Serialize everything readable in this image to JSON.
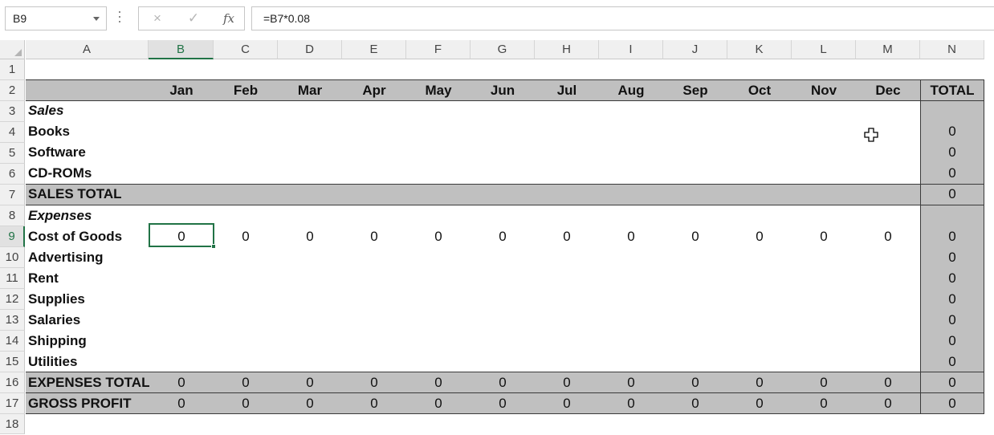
{
  "name_box": {
    "value": "B9"
  },
  "formula_bar": {
    "cancel_icon": "×",
    "enter_icon": "✓",
    "fx_label": "fx",
    "formula": "=B7*0.08"
  },
  "columns": [
    "A",
    "B",
    "C",
    "D",
    "E",
    "F",
    "G",
    "H",
    "I",
    "J",
    "K",
    "L",
    "M",
    "N"
  ],
  "rows": [
    "1",
    "2",
    "3",
    "4",
    "5",
    "6",
    "7",
    "8",
    "9",
    "10",
    "11",
    "12",
    "13",
    "14",
    "15",
    "16",
    "17",
    "18"
  ],
  "months": [
    "Jan",
    "Feb",
    "Mar",
    "Apr",
    "May",
    "Jun",
    "Jul",
    "Aug",
    "Sep",
    "Oct",
    "Nov",
    "Dec"
  ],
  "total_header": "TOTAL",
  "labels": {
    "sales": "Sales",
    "books": "Books",
    "software": "Software",
    "cdroms": "CD-ROMs",
    "sales_total": "SALES TOTAL",
    "expenses": "Expenses",
    "cost_of_goods": "Cost of Goods",
    "advertising": "Advertising",
    "rent": "Rent",
    "supplies": "Supplies",
    "salaries": "Salaries",
    "shipping": "Shipping",
    "utilities": "Utilities",
    "expenses_total": "EXPENSES TOTAL",
    "gross_profit": "GROSS PROFIT"
  },
  "totals": {
    "books": "0",
    "software": "0",
    "cdroms": "0",
    "sales_total": "0",
    "cost_of_goods": "0",
    "advertising": "0",
    "rent": "0",
    "supplies": "0",
    "salaries": "0",
    "shipping": "0",
    "utilities": "0",
    "expenses_total": "0",
    "gross_profit": "0"
  },
  "monthly": {
    "cost_of_goods": [
      "0",
      "0",
      "0",
      "0",
      "0",
      "0",
      "0",
      "0",
      "0",
      "0",
      "0",
      "0"
    ],
    "expenses_total": [
      "0",
      "0",
      "0",
      "0",
      "0",
      "0",
      "0",
      "0",
      "0",
      "0",
      "0",
      "0"
    ],
    "gross_profit": [
      "0",
      "0",
      "0",
      "0",
      "0",
      "0",
      "0",
      "0",
      "0",
      "0",
      "0",
      "0"
    ]
  },
  "selected_cell": "B9",
  "colors": {
    "accent": "#217346",
    "band_gray": "#c0c0c0",
    "header_gray": "#f0f0f0"
  },
  "icons": {
    "cursor": "cross-cursor-icon",
    "cancel": "close-icon",
    "enter": "check-icon",
    "function": "function-icon"
  }
}
